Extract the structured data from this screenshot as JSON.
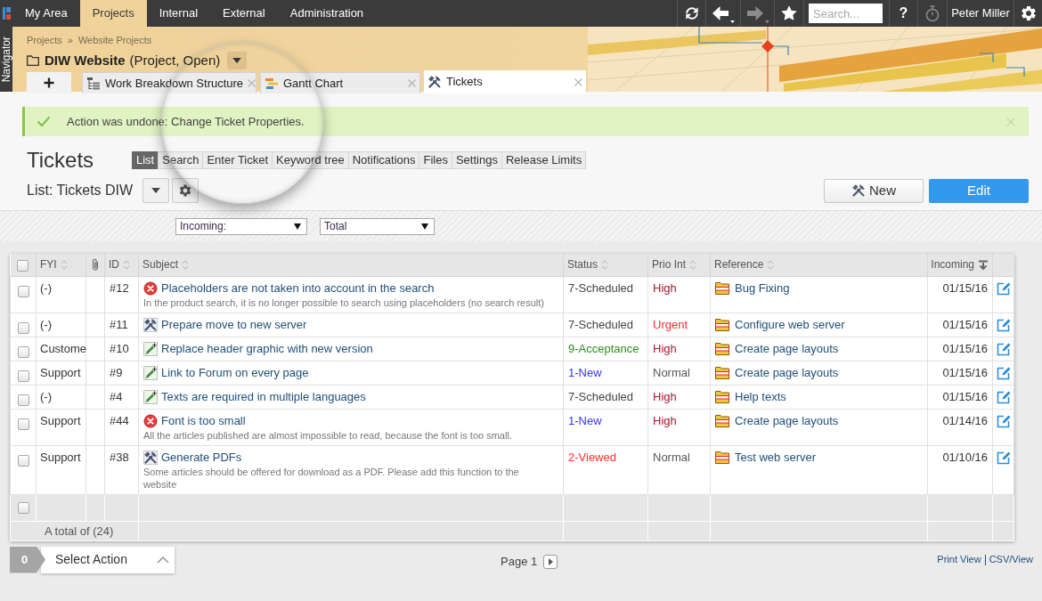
{
  "top_bar": {
    "nav": [
      {
        "label": "My Area",
        "selected": false
      },
      {
        "label": "Projects",
        "selected": true
      },
      {
        "label": "Internal",
        "selected": false
      },
      {
        "label": "External",
        "selected": false
      },
      {
        "label": "Administration",
        "selected": false
      }
    ],
    "toolbar": [
      {
        "kind": "refresh",
        "disabled": false
      },
      {
        "kind": "back",
        "disabled": false
      },
      {
        "kind": "forward",
        "disabled": true
      },
      {
        "kind": "favorites",
        "disabled": false
      },
      {
        "kind": "search",
        "placeholder": "Search...",
        "disabled": false
      },
      {
        "kind": "help",
        "label": "?",
        "disabled": false
      },
      {
        "kind": "timer",
        "disabled": true
      },
      {
        "kind": "user",
        "label": "Peter Miller",
        "disabled": false
      },
      {
        "kind": "settings",
        "disabled": false
      }
    ]
  },
  "navigator": {
    "label": "Navigator"
  },
  "project": {
    "breadcrumb": [
      "Projects",
      "Website Projects"
    ],
    "breadcrumb_separator": "»",
    "title": "DIW Website",
    "subtitle": "(Project, Open)"
  },
  "tabs": [
    {
      "kind": "wbs",
      "label": "Work Breakdown Structure",
      "selected": false
    },
    {
      "kind": "gantt",
      "label": "Gantt Chart",
      "selected": false
    },
    {
      "kind": "tickets",
      "label": "Tickets",
      "selected": true
    }
  ],
  "alert": {
    "kind": "success",
    "message": "Action was undone: Change Ticket Properties."
  },
  "page": {
    "title": "Tickets",
    "subtabs": [
      {
        "label": "List",
        "selected": true
      },
      {
        "label": "Search",
        "selected": false
      },
      {
        "label": "Enter Ticket",
        "selected": false
      },
      {
        "label": "Keyword tree",
        "selected": false
      },
      {
        "label": "Notifications",
        "selected": false
      },
      {
        "label": "Files",
        "selected": false
      },
      {
        "label": "Settings",
        "selected": false
      },
      {
        "label": "Release Limits",
        "selected": false
      }
    ],
    "list_title": "List: Tickets DIW",
    "buttons": [
      {
        "kind": "secondary",
        "label": "New"
      },
      {
        "kind": "primary",
        "label": "Edit"
      }
    ]
  },
  "filters": [
    {
      "value": "Incoming:"
    },
    {
      "value": "Total"
    }
  ],
  "table": {
    "select_all": {
      "checked": false
    },
    "columns": [
      {
        "kind": "text",
        "label": "FYI",
        "sorted": false
      },
      {
        "kind": "attachment"
      },
      {
        "kind": "text",
        "label": "ID",
        "sorted": false
      },
      {
        "kind": "text",
        "label": "Subject",
        "sorted": false
      },
      {
        "kind": "text",
        "label": "Status",
        "sorted": false
      },
      {
        "kind": "text",
        "label": "Prio Int",
        "sorted": false
      },
      {
        "kind": "text",
        "label": "Reference",
        "sorted": false
      },
      {
        "kind": "text",
        "label": "Incoming",
        "sorted": true
      }
    ],
    "rows": [
      {
        "checked": false,
        "kind": "error",
        "fyi": "(-)",
        "id": "#12",
        "subject": "Placeholders are not taken into account in the search",
        "description": "In the product search, it is no longer possible to search using placeholders (no search result)",
        "status": {
          "text": "7-Scheduled",
          "color": "#444444"
        },
        "prio": {
          "text": "High",
          "color": "#a3182e"
        },
        "reference": "Bug Fixing",
        "incoming": "01/15/16"
      },
      {
        "checked": false,
        "kind": "task",
        "fyi": "(-)",
        "id": "#11",
        "subject": "Prepare move to new server",
        "status": {
          "text": "7-Scheduled",
          "color": "#444444"
        },
        "prio": {
          "text": "Urgent",
          "color": "#ff2a2a"
        },
        "reference": "Configure web server",
        "incoming": "01/15/16"
      },
      {
        "checked": false,
        "kind": "change",
        "fyi": "Custome",
        "id": "#10",
        "subject": "Replace header graphic with new version",
        "status": {
          "text": "9-Acceptance",
          "color": "#2e8b1f"
        },
        "prio": {
          "text": "High",
          "color": "#a3182e"
        },
        "reference": "Create page layouts",
        "incoming": "01/15/16"
      },
      {
        "checked": false,
        "kind": "change",
        "fyi": "Support",
        "id": "#9",
        "subject": "Link to Forum on every page",
        "status": {
          "text": "1-New",
          "color": "#3333ff"
        },
        "prio": {
          "text": "Normal",
          "color": "#555555"
        },
        "reference": "Create page layouts",
        "incoming": "01/15/16"
      },
      {
        "checked": false,
        "kind": "change",
        "fyi": "(-)",
        "id": "#4",
        "subject": "Texts are required in multiple languages",
        "status": {
          "text": "7-Scheduled",
          "color": "#444444"
        },
        "prio": {
          "text": "High",
          "color": "#a3182e"
        },
        "reference": "Help texts",
        "incoming": "01/15/16"
      },
      {
        "checked": false,
        "kind": "error",
        "fyi": "Support",
        "id": "#44",
        "subject": "Font is too small",
        "description": "All the articles published are almost impossible to read, because the font is too small.",
        "status": {
          "text": "1-New",
          "color": "#3333ff"
        },
        "prio": {
          "text": "High",
          "color": "#a3182e"
        },
        "reference": "Create page layouts",
        "incoming": "01/14/16"
      },
      {
        "checked": false,
        "kind": "task",
        "fyi": "Support",
        "id": "#38",
        "subject": "Generate PDFs",
        "description": "Some articles should be offered for download as a PDF. Please add this function to the website",
        "status": {
          "text": "2-Viewed",
          "color": "#ff2a2a"
        },
        "prio": {
          "text": "Normal",
          "color": "#555555"
        },
        "reference": "Test web server",
        "incoming": "01/10/16"
      }
    ],
    "footer": {
      "checked": false,
      "total": "A total of (24)"
    }
  },
  "footer": {
    "selected_count": "0",
    "action": "Select Action",
    "page": "Page 1",
    "links": [
      "Print View",
      "CSV/View"
    ]
  }
}
